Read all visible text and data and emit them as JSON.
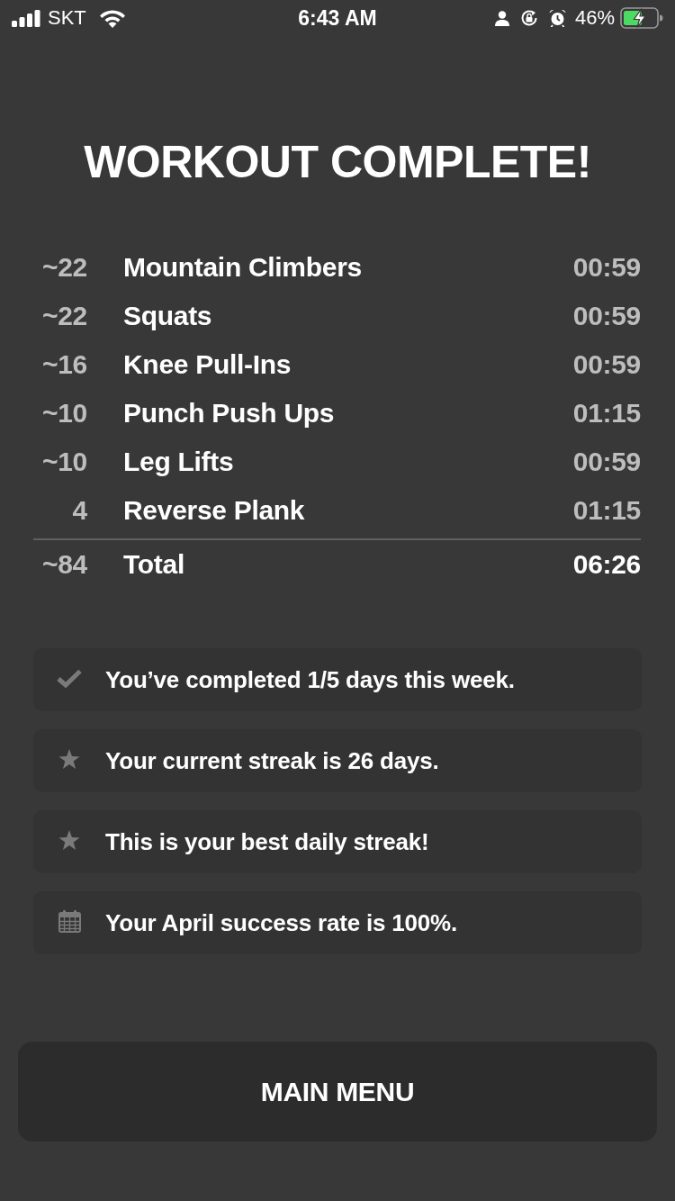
{
  "status_bar": {
    "carrier": "SKT",
    "time": "6:43 AM",
    "battery": "46%"
  },
  "title": "WORKOUT COMPLETE!",
  "exercises": [
    {
      "reps": "~22",
      "name": "Mountain Climbers",
      "duration": "00:59"
    },
    {
      "reps": "~22",
      "name": "Squats",
      "duration": "00:59"
    },
    {
      "reps": "~16",
      "name": "Knee Pull-Ins",
      "duration": "00:59"
    },
    {
      "reps": "~10",
      "name": "Punch Push Ups",
      "duration": "01:15"
    },
    {
      "reps": "~10",
      "name": "Leg Lifts",
      "duration": "00:59"
    },
    {
      "reps": "4",
      "name": "Reverse Plank",
      "duration": "01:15"
    }
  ],
  "total": {
    "reps": "~84",
    "label": "Total",
    "duration": "06:26"
  },
  "achievements": [
    {
      "kind": "check",
      "text": "You’ve completed 1/5 days this week."
    },
    {
      "kind": "star",
      "text": "Your current streak is 26 days."
    },
    {
      "kind": "star",
      "text": "This is your best daily streak!"
    },
    {
      "kind": "calendar",
      "text": "Your April success rate is 100%."
    }
  ],
  "button": "MAIN MENU"
}
